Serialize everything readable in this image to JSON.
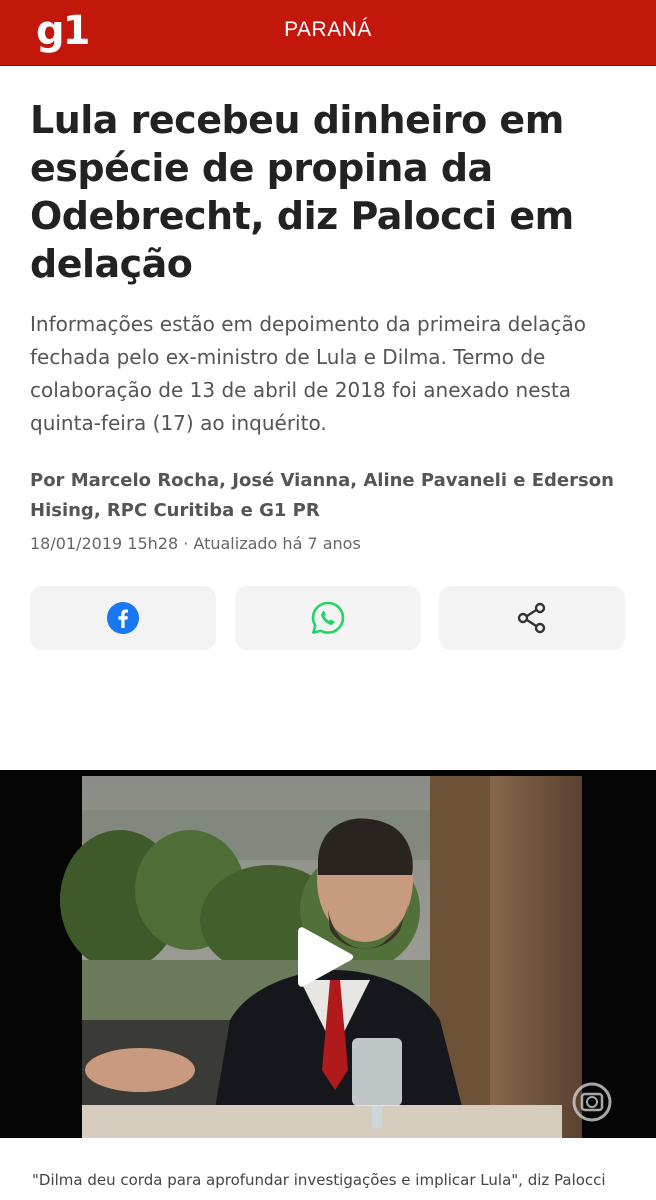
{
  "header": {
    "logo": "g1",
    "section": "PARANÁ",
    "brand_color": "#c4170c"
  },
  "article": {
    "title": "Lula recebeu dinheiro em espécie de propina da Odebrecht, diz Palocci em delação",
    "subtitle": "Informações estão em depoimento da primeira delação fechada pelo ex-ministro de Lula e Dilma. Termo de colaboração de 13 de abril de 2018 foi anexado nesta quinta-feira (17) ao inquérito.",
    "byline": "Por Marcelo Rocha, José Vianna, Aline Pavaneli e Ederson Hising, RPC Curitiba e G1 PR",
    "timestamp": "18/01/2019 15h28 · Atualizado há 7 anos"
  },
  "share": {
    "facebook_icon": "facebook-icon",
    "whatsapp_icon": "whatsapp-icon",
    "share_icon": "share-icon",
    "facebook_color": "#1877f2",
    "whatsapp_color": "#25d366"
  },
  "video": {
    "play_icon": "play-icon",
    "caption": "\"Dilma deu corda para aprofundar investigações e implicar Lula\", diz Palocci"
  }
}
